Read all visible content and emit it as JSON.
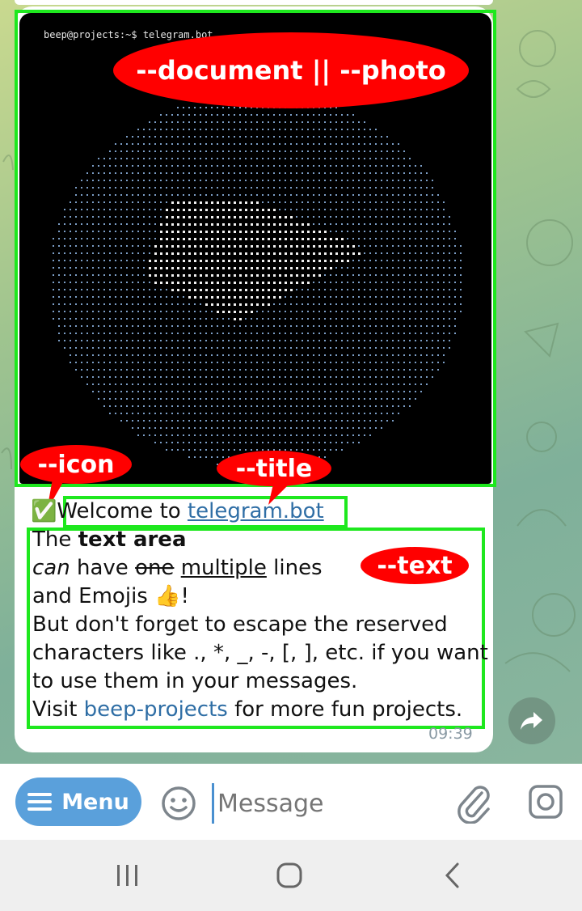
{
  "terminal": {
    "prompt": "beep@projects:~$ telegram.bot"
  },
  "callouts": {
    "document": "--document || --photo",
    "icon": "--icon",
    "title": "--title",
    "text": "--text"
  },
  "message": {
    "icon": "✅",
    "title_prefix": "Welcome to ",
    "title_link": "telegram.bot",
    "line1_plain": "The ",
    "line1_bold": "text area",
    "line2_italic": "can",
    "line2_a": " have ",
    "line2_strike": "one",
    "line2_b": " ",
    "line2_underline": "multiple",
    "line2_c": " lines",
    "line3_a": "and Emojis ",
    "line3_emoji": "👍",
    "line3_b": "!",
    "line4": "But don't forget to escape the reserved",
    "line5": "characters like ., *, _, -, [, ], etc. if you want",
    "line6": "to use them in your messages.",
    "line7_a": "Visit ",
    "line7_link": "beep-projects",
    "line7_b": " for more fun projects.",
    "time": "09:39"
  },
  "input": {
    "menu_label": "Menu",
    "placeholder": "Message"
  },
  "colors": {
    "highlight": "#1ee81e",
    "callout": "#ff0000",
    "link": "#2f6ea5",
    "menu": "#5aa0db"
  }
}
